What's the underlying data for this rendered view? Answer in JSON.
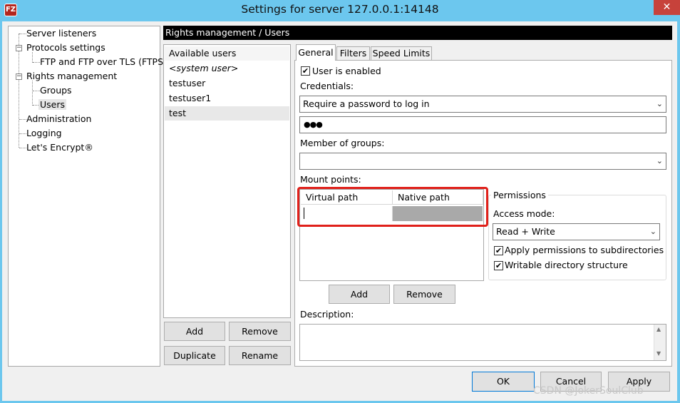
{
  "window": {
    "title": "Settings for server 127.0.0.1:14148",
    "close_glyph": "✕",
    "app_icon_text": "FZ"
  },
  "tree": {
    "items": [
      {
        "label": "Server listeners"
      },
      {
        "label": "Protocols settings"
      },
      {
        "label": "FTP and FTP over TLS (FTPS)"
      },
      {
        "label": "Rights management"
      },
      {
        "label": "Groups"
      },
      {
        "label": "Users"
      },
      {
        "label": "Administration"
      },
      {
        "label": "Logging"
      },
      {
        "label": "Let's Encrypt®"
      }
    ],
    "expander_glyph": "−"
  },
  "header": {
    "title": "Rights management / Users"
  },
  "users": {
    "heading": "Available users",
    "items": [
      "<system user>",
      "testuser",
      "testuser1",
      "test"
    ],
    "selected": "test",
    "add_label": "Add",
    "remove_label": "Remove",
    "duplicate_label": "Duplicate",
    "rename_label": "Rename"
  },
  "tabs": [
    {
      "label": "General",
      "active": true
    },
    {
      "label": "Filters",
      "active": false
    },
    {
      "label": "Speed Limits",
      "active": false
    }
  ],
  "general": {
    "user_enabled_label": "User is enabled",
    "user_enabled_checked": true,
    "credentials_label": "Credentials:",
    "credentials_value": "Require a password to log in",
    "password_value": "●●●",
    "groups_label": "Member of groups:",
    "groups_value": "",
    "mount_points_label": "Mount points:",
    "mount_columns": [
      "Virtual path",
      "Native path"
    ],
    "mount_add_label": "Add",
    "mount_remove_label": "Remove",
    "permissions_title": "Permissions",
    "access_mode_label": "Access mode:",
    "access_mode_value": "Read + Write",
    "apply_subdirs_label": "Apply permissions to subdirectories",
    "apply_subdirs_checked": true,
    "writable_dir_label": "Writable directory structure",
    "writable_dir_checked": true,
    "description_label": "Description:",
    "description_value": "",
    "chevron_glyph": "⌄",
    "check_glyph": "✔",
    "scroll_up": "▲",
    "scroll_down": "▼"
  },
  "footer": {
    "ok_label": "OK",
    "cancel_label": "Cancel",
    "apply_label": "Apply"
  },
  "watermark": "CSDN @JokerSoulClub",
  "colors": {
    "highlight": "#e0201a",
    "titlebar": "#6cc7ee",
    "header": "#000000"
  }
}
